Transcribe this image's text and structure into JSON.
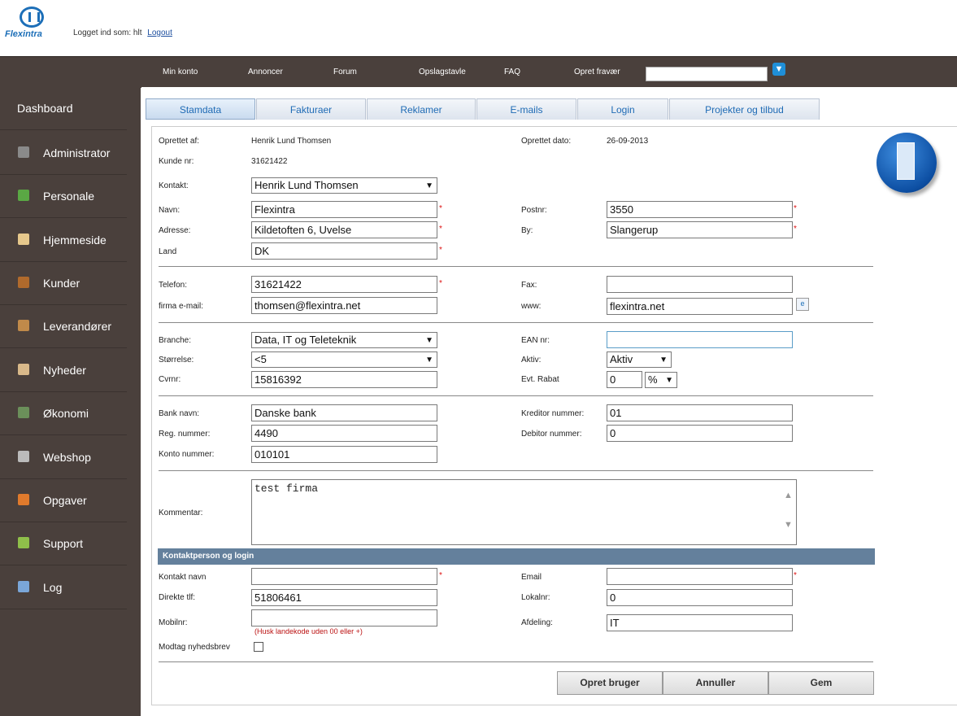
{
  "header": {
    "logo_text": "Flexintra",
    "logged_in_label": "Logget ind som: hlt",
    "logout_label": "Logout"
  },
  "topnav": {
    "items": [
      "Min konto",
      "Annoncer",
      "Forum",
      "Opslagstavle",
      "FAQ",
      "Opret fravær"
    ],
    "search_value": ""
  },
  "sidebar": {
    "items": [
      {
        "label": "Dashboard",
        "icon": "dashboard-icon"
      },
      {
        "label": "Administrator",
        "icon": "admin-icon",
        "color": "#8a8a8a"
      },
      {
        "label": "Personale",
        "icon": "personale-icon",
        "color": "#5aa844"
      },
      {
        "label": "Hjemmeside",
        "icon": "hjemmeside-icon",
        "color": "#e6c88c"
      },
      {
        "label": "Kunder",
        "icon": "kunder-icon",
        "color": "#b06a2c"
      },
      {
        "label": "Leverandører",
        "icon": "leverandorer-icon",
        "color": "#c08a4a"
      },
      {
        "label": "Nyheder",
        "icon": "nyheder-icon",
        "color": "#d9b98a"
      },
      {
        "label": "Økonomi",
        "icon": "okonomi-icon",
        "color": "#6b8f5a"
      },
      {
        "label": "Webshop",
        "icon": "webshop-icon",
        "color": "#bbbbbb"
      },
      {
        "label": "Opgaver",
        "icon": "opgaver-icon",
        "color": "#e07a2c"
      },
      {
        "label": "Support",
        "icon": "support-icon",
        "color": "#8fbf4a"
      },
      {
        "label": "Log",
        "icon": "log-icon",
        "color": "#7aa6d8"
      }
    ]
  },
  "tabs": [
    "Stamdata",
    "Fakturaer",
    "Reklamer",
    "E-mails",
    "Login",
    "Projekter og tilbud"
  ],
  "form": {
    "oprettet_af_label": "Oprettet af:",
    "oprettet_af": "Henrik Lund Thomsen",
    "oprettet_dato_label": "Oprettet dato:",
    "oprettet_dato": "26-09-2013",
    "kunde_nr_label": "Kunde nr:",
    "kunde_nr": "31621422",
    "kontakt_label": "Kontakt:",
    "kontakt": "Henrik Lund Thomsen",
    "navn_label": "Navn:",
    "navn": "Flexintra",
    "postnr_label": "Postnr:",
    "postnr": "3550",
    "adresse_label": "Adresse:",
    "adresse": "Kildetoften 6, Uvelse",
    "by_label": "By:",
    "by": "Slangerup",
    "land_label": "Land",
    "land": "DK",
    "telefon_label": "Telefon:",
    "telefon": "31621422",
    "fax_label": "Fax:",
    "fax": "",
    "email_label": "firma e-mail:",
    "email": "thomsen@flexintra.net",
    "www_label": "www:",
    "www": "flexintra.net",
    "branche_label": "Branche:",
    "branche": "Data, IT og Teleteknik",
    "ean_label": "EAN nr:",
    "ean": "",
    "storrelse_label": "Størrelse:",
    "storrelse": "<5",
    "aktiv_label": "Aktiv:",
    "aktiv": "Aktiv",
    "cvr_label": "Cvrnr:",
    "cvr": "15816392",
    "rabat_label": "Evt. Rabat",
    "rabat": "0",
    "rabat_unit": "%",
    "bank_label": "Bank navn:",
    "bank": "Danske bank",
    "kreditor_label": "Kreditor nummer:",
    "kreditor": "01",
    "reg_label": "Reg. nummer:",
    "reg": "4490",
    "debitor_label": "Debitor nummer:",
    "debitor": "0",
    "konto_label": "Konto nummer:",
    "konto": "010101",
    "kommentar_label": "Kommentar:",
    "kommentar": "test firma",
    "section_title": "Kontaktperson og login",
    "kontakt_navn_label": "Kontakt navn",
    "kontakt_navn": "",
    "kp_email_label": "Email",
    "kp_email": "",
    "direkte_label": "Direkte tlf:",
    "direkte": "51806461",
    "lokal_label": "Lokalnr:",
    "lokal": "0",
    "mobil_label": "Mobilnr:",
    "mobil": "",
    "mobil_hint": "(Husk landekode uden 00 eller +)",
    "afdeling_label": "Afdeling:",
    "afdeling": "IT",
    "nyhedsbrev_label": "Modtag nyhedsbrev",
    "required_mark": "*"
  },
  "buttons": {
    "opret": "Opret bruger",
    "annuller": "Annuller",
    "gem": "Gem"
  }
}
